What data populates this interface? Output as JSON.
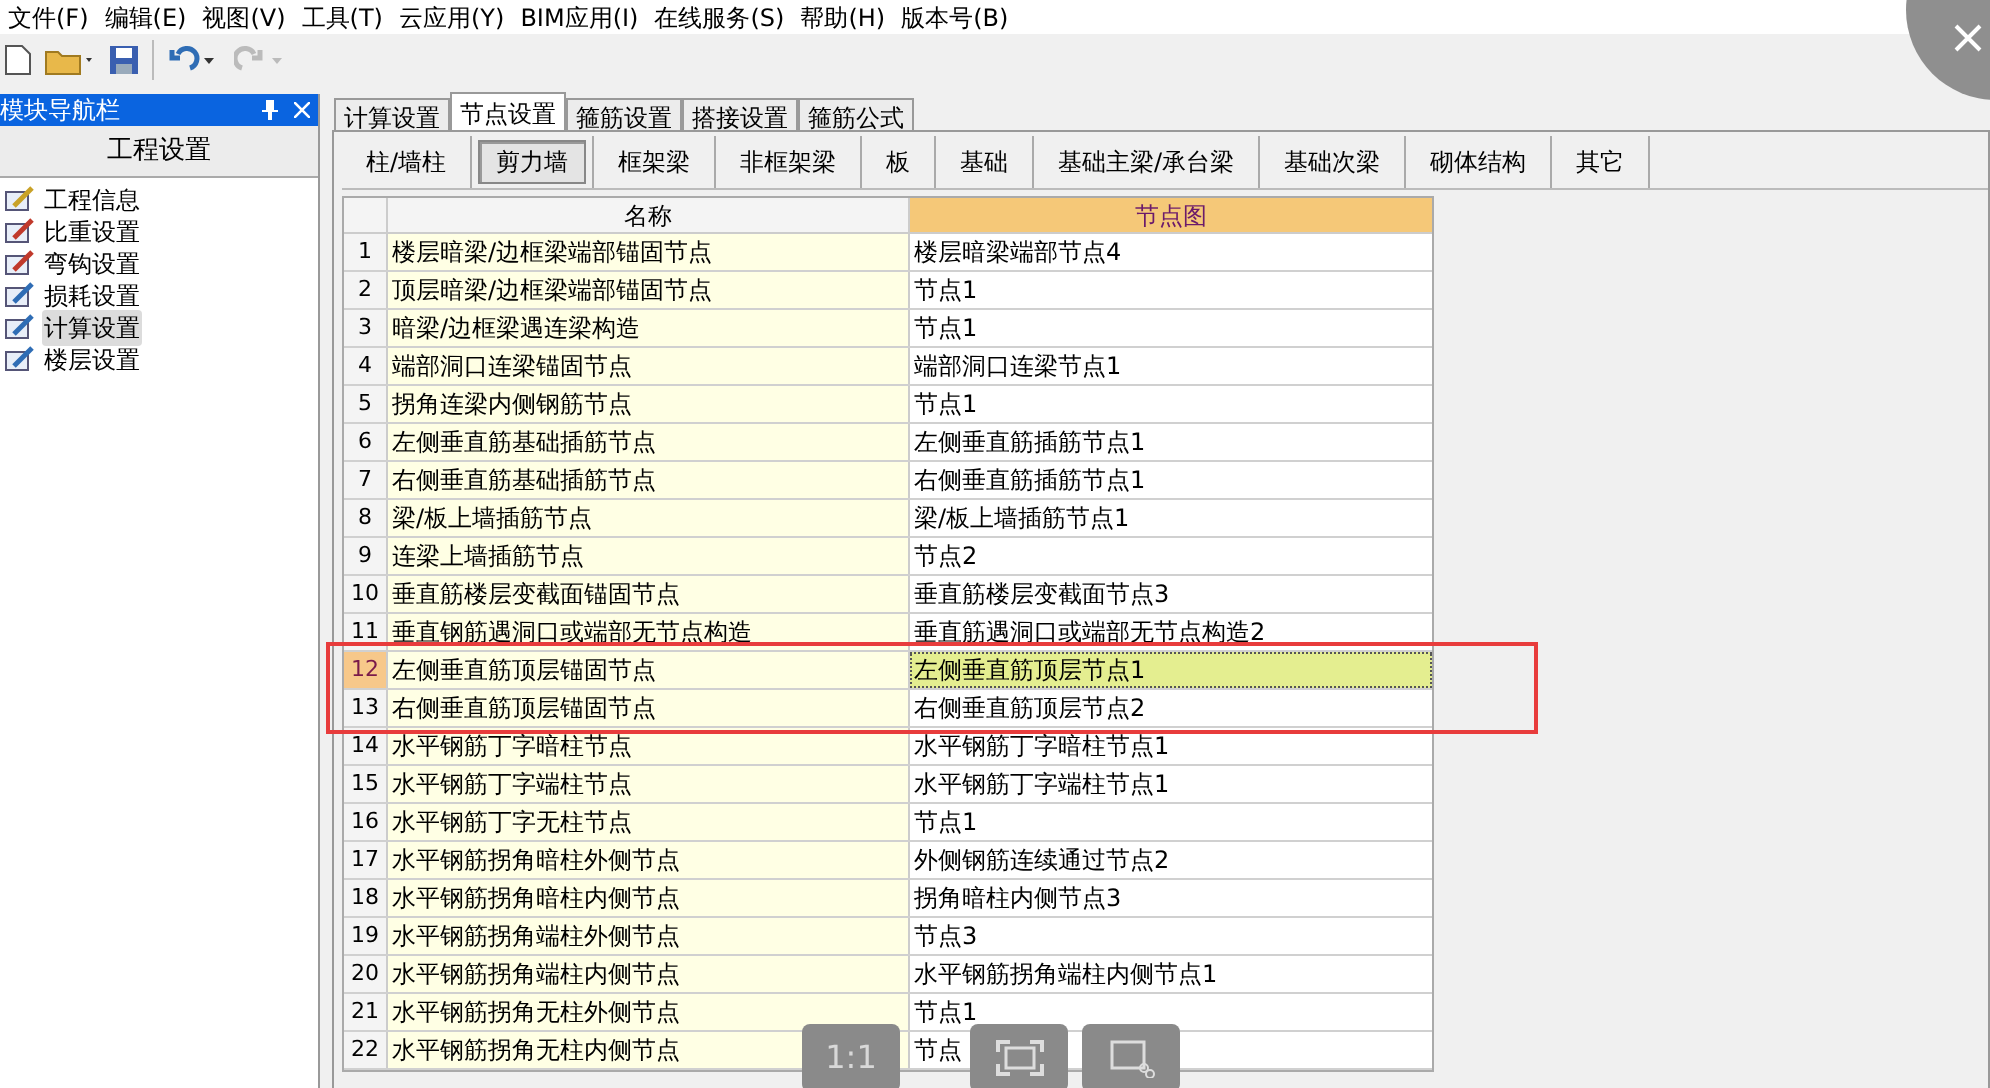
{
  "menu": [
    "文件(F)",
    "编辑(E)",
    "视图(V)",
    "工具(T)",
    "云应用(Y)",
    "BIM应用(I)",
    "在线服务(S)",
    "帮助(H)",
    "版本号(B)"
  ],
  "nav": {
    "title": "模块导航栏",
    "section": "工程设置",
    "items": [
      {
        "label": "工程信息",
        "selected": false
      },
      {
        "label": "比重设置",
        "selected": false
      },
      {
        "label": "弯钩设置",
        "selected": false
      },
      {
        "label": "损耗设置",
        "selected": false
      },
      {
        "label": "计算设置",
        "selected": true
      },
      {
        "label": "楼层设置",
        "selected": false
      }
    ]
  },
  "tabs": [
    {
      "label": "计算设置",
      "selected": false
    },
    {
      "label": "节点设置",
      "selected": true
    },
    {
      "label": "箍筋设置",
      "selected": false
    },
    {
      "label": "搭接设置",
      "selected": false
    },
    {
      "label": "箍筋公式",
      "selected": false
    }
  ],
  "subtabs": [
    {
      "label": "柱/墙柱",
      "selected": false
    },
    {
      "label": "剪力墙",
      "selected": true
    },
    {
      "label": "框架梁",
      "selected": false
    },
    {
      "label": "非框架梁",
      "selected": false
    },
    {
      "label": "板",
      "selected": false
    },
    {
      "label": "基础",
      "selected": false
    },
    {
      "label": "基础主梁/承台梁",
      "selected": false
    },
    {
      "label": "基础次梁",
      "selected": false
    },
    {
      "label": "砌体结构",
      "selected": false
    },
    {
      "label": "其它",
      "selected": false
    }
  ],
  "table": {
    "columns": [
      "名称",
      "节点图"
    ],
    "rows": [
      {
        "no": "1",
        "name": "楼层暗梁/边框梁端部锚固节点",
        "node": "楼层暗梁端部节点4",
        "selected": false
      },
      {
        "no": "2",
        "name": "顶层暗梁/边框梁端部锚固节点",
        "node": "节点1",
        "selected": false
      },
      {
        "no": "3",
        "name": "暗梁/边框梁遇连梁构造",
        "node": "节点1",
        "selected": false
      },
      {
        "no": "4",
        "name": "端部洞口连梁锚固节点",
        "node": "端部洞口连梁节点1",
        "selected": false
      },
      {
        "no": "5",
        "name": "拐角连梁内侧钢筋节点",
        "node": "节点1",
        "selected": false
      },
      {
        "no": "6",
        "name": "左侧垂直筋基础插筋节点",
        "node": "左侧垂直筋插筋节点1",
        "selected": false
      },
      {
        "no": "7",
        "name": "右侧垂直筋基础插筋节点",
        "node": "右侧垂直筋插筋节点1",
        "selected": false
      },
      {
        "no": "8",
        "name": "梁/板上墙插筋节点",
        "node": "梁/板上墙插筋节点1",
        "selected": false
      },
      {
        "no": "9",
        "name": "连梁上墙插筋节点",
        "node": "节点2",
        "selected": false
      },
      {
        "no": "10",
        "name": "垂直筋楼层变截面锚固节点",
        "node": "垂直筋楼层变截面节点3",
        "selected": false
      },
      {
        "no": "11",
        "name": "垂直钢筋遇洞口或端部无节点构造",
        "node": "垂直筋遇洞口或端部无节点构造2",
        "selected": false
      },
      {
        "no": "12",
        "name": "左侧垂直筋顶层锚固节点",
        "node": "左侧垂直筋顶层节点1",
        "selected": true
      },
      {
        "no": "13",
        "name": "右侧垂直筋顶层锚固节点",
        "node": "右侧垂直筋顶层节点2",
        "selected": false
      },
      {
        "no": "14",
        "name": "水平钢筋丁字暗柱节点",
        "node": "水平钢筋丁字暗柱节点1",
        "selected": false
      },
      {
        "no": "15",
        "name": "水平钢筋丁字端柱节点",
        "node": "水平钢筋丁字端柱节点1",
        "selected": false
      },
      {
        "no": "16",
        "name": "水平钢筋丁字无柱节点",
        "node": "节点1",
        "selected": false
      },
      {
        "no": "17",
        "name": "水平钢筋拐角暗柱外侧节点",
        "node": "外侧钢筋连续通过节点2",
        "selected": false
      },
      {
        "no": "18",
        "name": "水平钢筋拐角暗柱内侧节点",
        "node": "拐角暗柱内侧节点3",
        "selected": false
      },
      {
        "no": "19",
        "name": "水平钢筋拐角端柱外侧节点",
        "node": "节点3",
        "selected": false
      },
      {
        "no": "20",
        "name": "水平钢筋拐角端柱内侧节点",
        "node": "水平钢筋拐角端柱内侧节点1",
        "selected": false
      },
      {
        "no": "21",
        "name": "水平钢筋拐角无柱外侧节点",
        "node": "节点1",
        "selected": false
      },
      {
        "no": "22",
        "name": "水平钢筋拐角无柱内侧节点",
        "node": "节点",
        "selected": false
      }
    ]
  },
  "viewer": {
    "actual_size": "1:1"
  }
}
